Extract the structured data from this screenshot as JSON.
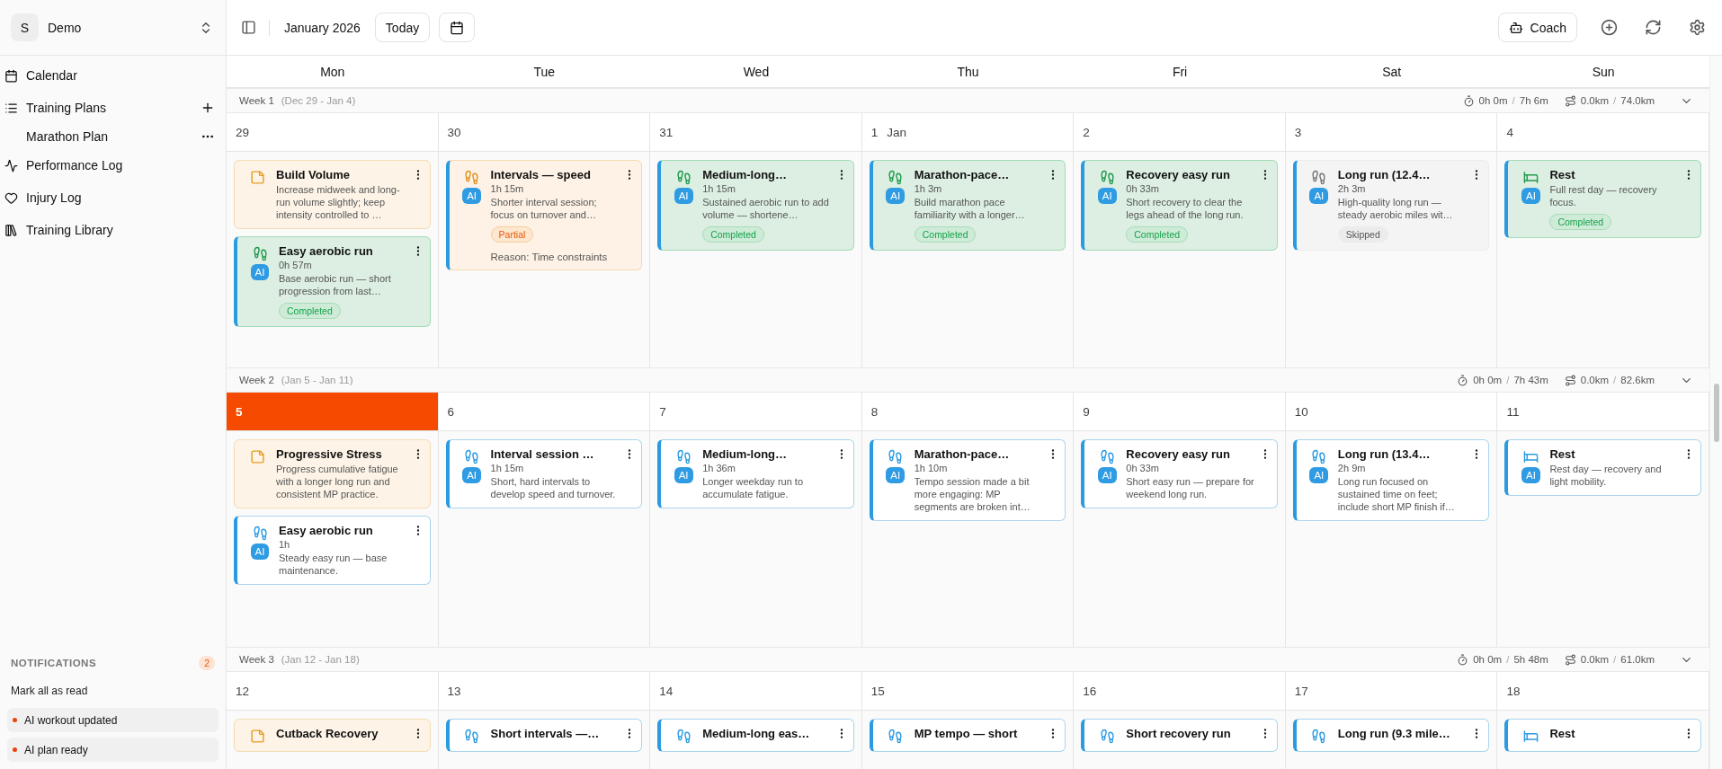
{
  "workspace": {
    "initial": "S",
    "name": "Demo"
  },
  "nav": [
    {
      "label": "Calendar"
    },
    {
      "label": "Training Plans",
      "children": [
        {
          "label": "Marathon Plan"
        }
      ]
    },
    {
      "label": "Performance Log"
    },
    {
      "label": "Injury Log"
    },
    {
      "label": "Training Library"
    }
  ],
  "notifications": {
    "title": "NOTIFICATIONS",
    "count": "2",
    "mark_all": "Mark all as read",
    "items": [
      {
        "text": "AI workout updated",
        "unread": true
      },
      {
        "text": "AI plan ready",
        "unread": true
      }
    ]
  },
  "toolbar": {
    "month": "January 2026",
    "today": "Today",
    "coach": "Coach"
  },
  "weekdays": [
    "Mon",
    "Tue",
    "Wed",
    "Thu",
    "Fri",
    "Sat",
    "Sun"
  ],
  "weeks": [
    {
      "label": "Week 1",
      "range": "(Dec 29 - Jan 4)",
      "time_done": "0h 0m",
      "time_sep": "/",
      "time_planned": "7h 6m",
      "dist_done": "0.0km",
      "dist_sep": "/",
      "dist_planned": "74.0km",
      "expanded": true,
      "days": [
        {
          "date": "29",
          "today": false,
          "cards": [
            {
              "kind": "note",
              "title": "Build Volume",
              "description": "Increase midweek and long-run volume slightly; keep intensity controlled to …"
            },
            {
              "kind": "run",
              "completed": true,
              "partial": false,
              "skipped": false,
              "ai": "AI",
              "title": "Easy aerobic run",
              "duration": "0h 57m",
              "description": "Base aerobic run — short progression from last…",
              "badge": "Completed"
            }
          ]
        },
        {
          "date": "30",
          "today": false,
          "cards": [
            {
              "kind": "run",
              "completed": false,
              "partial": true,
              "skipped": false,
              "ai": "AI",
              "title": "Intervals — speed",
              "duration": "1h 15m",
              "description": "Shorter interval session; focus on turnover and…",
              "badge": "Partial",
              "reason": "Reason: Time constraints"
            }
          ]
        },
        {
          "date": "31",
          "today": false,
          "cards": [
            {
              "kind": "run",
              "completed": true,
              "partial": false,
              "skipped": false,
              "ai": "AI",
              "title": "Medium-long…",
              "duration": "1h 15m",
              "description": "Sustained aerobic run to add volume — shortene…",
              "badge": "Completed"
            }
          ]
        },
        {
          "date": "1",
          "month": "Jan",
          "today": false,
          "cards": [
            {
              "kind": "run",
              "completed": true,
              "partial": false,
              "skipped": false,
              "ai": "AI",
              "title": "Marathon-pace…",
              "duration": "1h 3m",
              "description": "Build marathon pace familiarity with a longer…",
              "badge": "Completed"
            }
          ]
        },
        {
          "date": "2",
          "today": false,
          "cards": [
            {
              "kind": "run",
              "completed": true,
              "partial": false,
              "skipped": false,
              "ai": "AI",
              "title": "Recovery easy run",
              "duration": "0h 33m",
              "description": "Short recovery to clear the legs ahead of the long run.",
              "badge": "Completed"
            }
          ]
        },
        {
          "date": "3",
          "today": false,
          "cards": [
            {
              "kind": "run",
              "completed": false,
              "partial": false,
              "skipped": true,
              "ai": "AI",
              "title": "Long run (12.4…",
              "duration": "2h 3m",
              "description": "High-quality long run — steady aerobic miles wit…",
              "badge": "Skipped"
            }
          ]
        },
        {
          "date": "4",
          "today": false,
          "cards": [
            {
              "kind": "rest",
              "completed": true,
              "partial": false,
              "skipped": false,
              "ai": "AI",
              "title": "Rest",
              "description": "Full rest day — recovery focus.",
              "badge": "Completed"
            }
          ]
        }
      ]
    },
    {
      "label": "Week 2",
      "range": "(Jan 5 - Jan 11)",
      "time_done": "0h 0m",
      "time_sep": "/",
      "time_planned": "7h 43m",
      "dist_done": "0.0km",
      "dist_sep": "/",
      "dist_planned": "82.6km",
      "expanded": true,
      "days": [
        {
          "date": "5",
          "today": true,
          "cards": [
            {
              "kind": "note",
              "title": "Progressive Stress",
              "description": "Progress cumulative fatigue with a longer long run and consistent MP practice."
            },
            {
              "kind": "run",
              "completed": false,
              "partial": false,
              "skipped": false,
              "ai": "AI",
              "title": "Easy aerobic run",
              "duration": "1h",
              "description": "Steady easy run — base maintenance."
            }
          ]
        },
        {
          "date": "6",
          "today": false,
          "cards": [
            {
              "kind": "run",
              "completed": false,
              "partial": false,
              "skipped": false,
              "ai": "AI",
              "title": "Interval session …",
              "duration": "1h 15m",
              "description": "Short, hard intervals to develop speed and turnover."
            }
          ]
        },
        {
          "date": "7",
          "today": false,
          "cards": [
            {
              "kind": "run",
              "completed": false,
              "partial": false,
              "skipped": false,
              "ai": "AI",
              "title": "Medium-long…",
              "duration": "1h 36m",
              "description": "Longer weekday run to accumulate fatigue."
            }
          ]
        },
        {
          "date": "8",
          "today": false,
          "cards": [
            {
              "kind": "run",
              "completed": false,
              "partial": false,
              "skipped": false,
              "ai": "AI",
              "title": "Marathon-pace…",
              "duration": "1h 10m",
              "description": "Tempo session made a bit more engaging: MP segments are broken int…"
            }
          ]
        },
        {
          "date": "9",
          "today": false,
          "cards": [
            {
              "kind": "run",
              "completed": false,
              "partial": false,
              "skipped": false,
              "ai": "AI",
              "title": "Recovery easy run",
              "duration": "0h 33m",
              "description": "Short easy run — prepare for weekend long run."
            }
          ]
        },
        {
          "date": "10",
          "today": false,
          "cards": [
            {
              "kind": "run",
              "completed": false,
              "partial": false,
              "skipped": false,
              "ai": "AI",
              "title": "Long run (13.4…",
              "duration": "2h 9m",
              "description": "Long run focused on sustained time on feet; include short MP finish if…"
            }
          ]
        },
        {
          "date": "11",
          "today": false,
          "cards": [
            {
              "kind": "rest",
              "completed": false,
              "partial": false,
              "skipped": false,
              "ai": "AI",
              "title": "Rest",
              "description": "Rest day — recovery and light mobility."
            }
          ]
        }
      ]
    },
    {
      "label": "Week 3",
      "range": "(Jan 12 - Jan 18)",
      "time_done": "0h 0m",
      "time_sep": "/",
      "time_planned": "5h 48m",
      "dist_done": "0.0km",
      "dist_sep": "/",
      "dist_planned": "61.0km",
      "expanded": true,
      "days": [
        {
          "date": "12",
          "today": false,
          "cards": [
            {
              "kind": "note",
              "title": "Cutback Recovery"
            }
          ]
        },
        {
          "date": "13",
          "today": false,
          "cards": [
            {
              "kind": "run",
              "completed": false,
              "partial": false,
              "skipped": false,
              "title": "Short intervals —…"
            }
          ]
        },
        {
          "date": "14",
          "today": false,
          "cards": [
            {
              "kind": "run",
              "completed": false,
              "partial": false,
              "skipped": false,
              "title": "Medium-long eas…"
            }
          ]
        },
        {
          "date": "15",
          "today": false,
          "cards": [
            {
              "kind": "run",
              "completed": false,
              "partial": false,
              "skipped": false,
              "title": "MP tempo — short"
            }
          ]
        },
        {
          "date": "16",
          "today": false,
          "cards": [
            {
              "kind": "run",
              "completed": false,
              "partial": false,
              "skipped": false,
              "title": "Short recovery run"
            }
          ]
        },
        {
          "date": "17",
          "today": false,
          "cards": [
            {
              "kind": "run",
              "completed": false,
              "partial": false,
              "skipped": false,
              "title": "Long run (9.3 mile…"
            }
          ]
        },
        {
          "date": "18",
          "today": false,
          "cards": [
            {
              "kind": "rest",
              "completed": false,
              "partial": false,
              "skipped": false,
              "title": "Rest"
            }
          ]
        }
      ]
    }
  ]
}
